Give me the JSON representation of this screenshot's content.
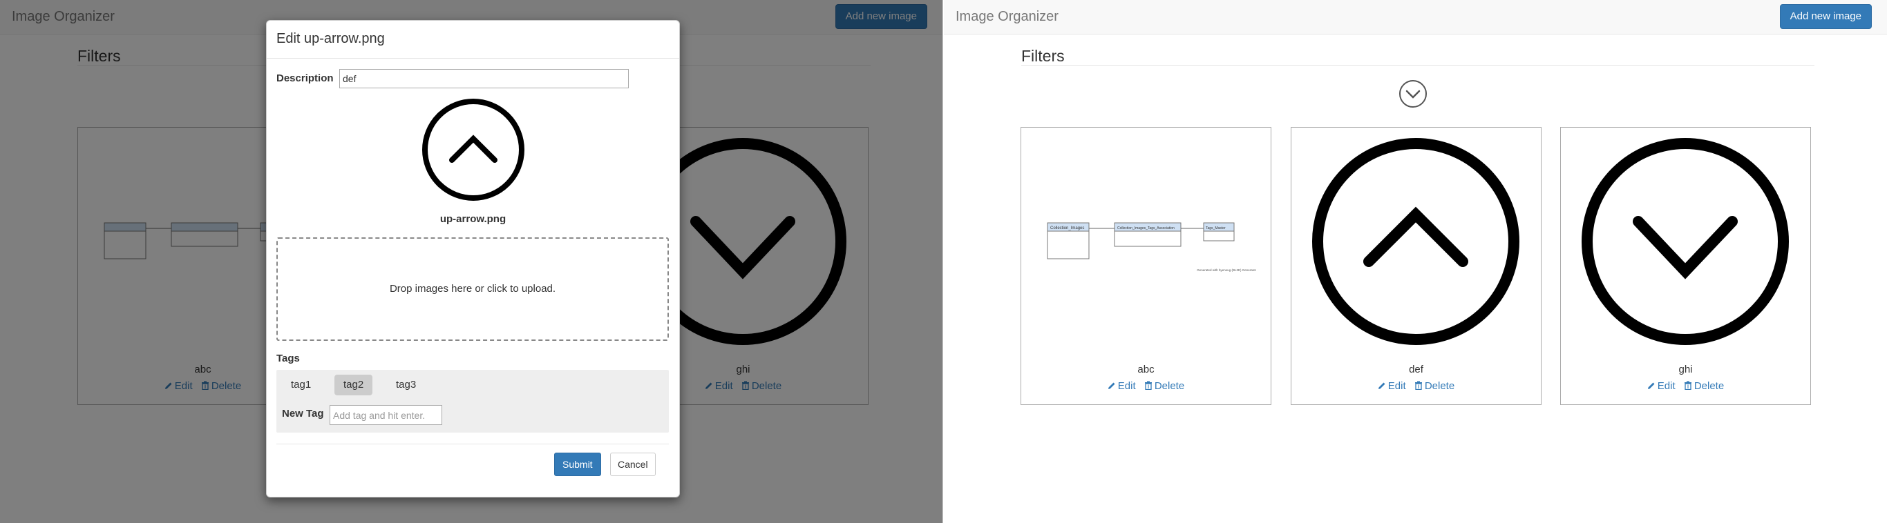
{
  "app": {
    "brand": "Image Organizer",
    "add_button": "Add new image"
  },
  "filters": {
    "title": "Filters",
    "toggle_icon": "chevron-down-circle-icon"
  },
  "images": [
    {
      "caption": "abc",
      "kind": "diagram",
      "edit": "Edit",
      "delete": "Delete"
    },
    {
      "caption": "def",
      "kind": "up-arrow",
      "edit": "Edit",
      "delete": "Delete"
    },
    {
      "caption": "ghi",
      "kind": "down-arrow",
      "edit": "Edit",
      "delete": "Delete"
    }
  ],
  "diagram_text": {
    "box1": "Collection_Images",
    "box2": "Collection_Images_Tags_Association",
    "box3": "Tags_Master",
    "footnote": "Generated with byenoug (BL2E) Generator"
  },
  "modal": {
    "title": "Edit up-arrow.png",
    "description_label": "Description",
    "description_value": "def",
    "preview_name": "up-arrow.png",
    "dropzone_text": "Drop images here or click to upload.",
    "tags_label": "Tags",
    "tags": [
      {
        "label": "tag1",
        "selected": false
      },
      {
        "label": "tag2",
        "selected": true
      },
      {
        "label": "tag3",
        "selected": false
      }
    ],
    "new_tag_label": "New Tag",
    "new_tag_placeholder": "Add tag and hit enter.",
    "submit": "Submit",
    "cancel": "Cancel"
  },
  "colors": {
    "primary": "#337ab7",
    "backdrop": "rgba(0,0,0,0.5)"
  }
}
